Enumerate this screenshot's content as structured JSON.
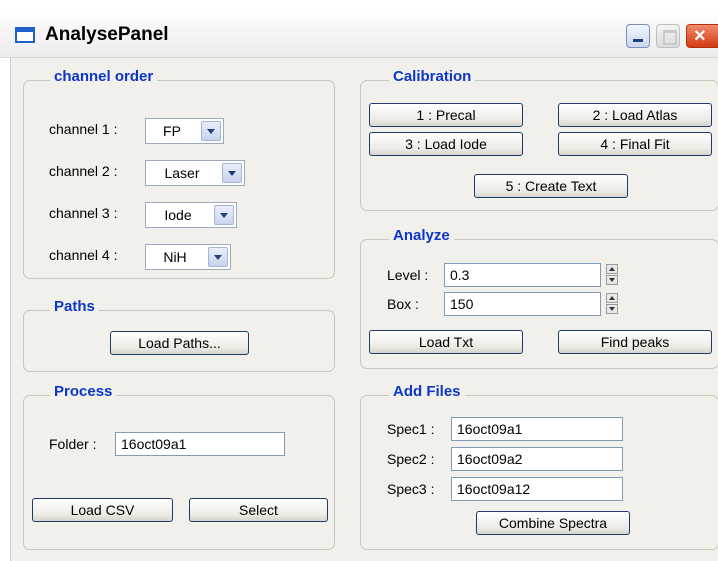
{
  "window": {
    "title": "AnalysePanel"
  },
  "channel_order": {
    "title": "channel order",
    "channels": [
      {
        "label": "channel 1 :",
        "value": "FP"
      },
      {
        "label": "channel 2 :",
        "value": "Laser"
      },
      {
        "label": "channel 3 :",
        "value": "Iode"
      },
      {
        "label": "channel 4 :",
        "value": "NiH"
      }
    ]
  },
  "paths": {
    "title": "Paths",
    "load_button": "Load Paths..."
  },
  "process": {
    "title": "Process",
    "folder_label": "Folder :",
    "folder_value": "16oct09a1",
    "load_csv": "Load CSV",
    "select": "Select"
  },
  "calibration": {
    "title": "Calibration",
    "precal": "1 : Precal",
    "load_atlas": "2 : Load Atlas",
    "load_iode": "3 : Load Iode",
    "final_fit": "4 : Final Fit",
    "create_text": "5 : Create Text"
  },
  "analyze": {
    "title": "Analyze",
    "level_label": "Level :",
    "level_value": "0.3",
    "box_label": "Box :",
    "box_value": "150",
    "load_txt": "Load Txt",
    "find_peaks": "Find peaks"
  },
  "add_files": {
    "title": "Add Files",
    "specs": [
      {
        "label": "Spec1 :",
        "value": "16oct09a1"
      },
      {
        "label": "Spec2 :",
        "value": "16oct09a2"
      },
      {
        "label": "Spec3 :",
        "value": "16oct09a12"
      }
    ],
    "combine": "Combine Spectra"
  },
  "colors": {
    "group_title": "#0d37c8",
    "panel_bg": "#f1f0ea",
    "close_button": "#d33b12"
  }
}
